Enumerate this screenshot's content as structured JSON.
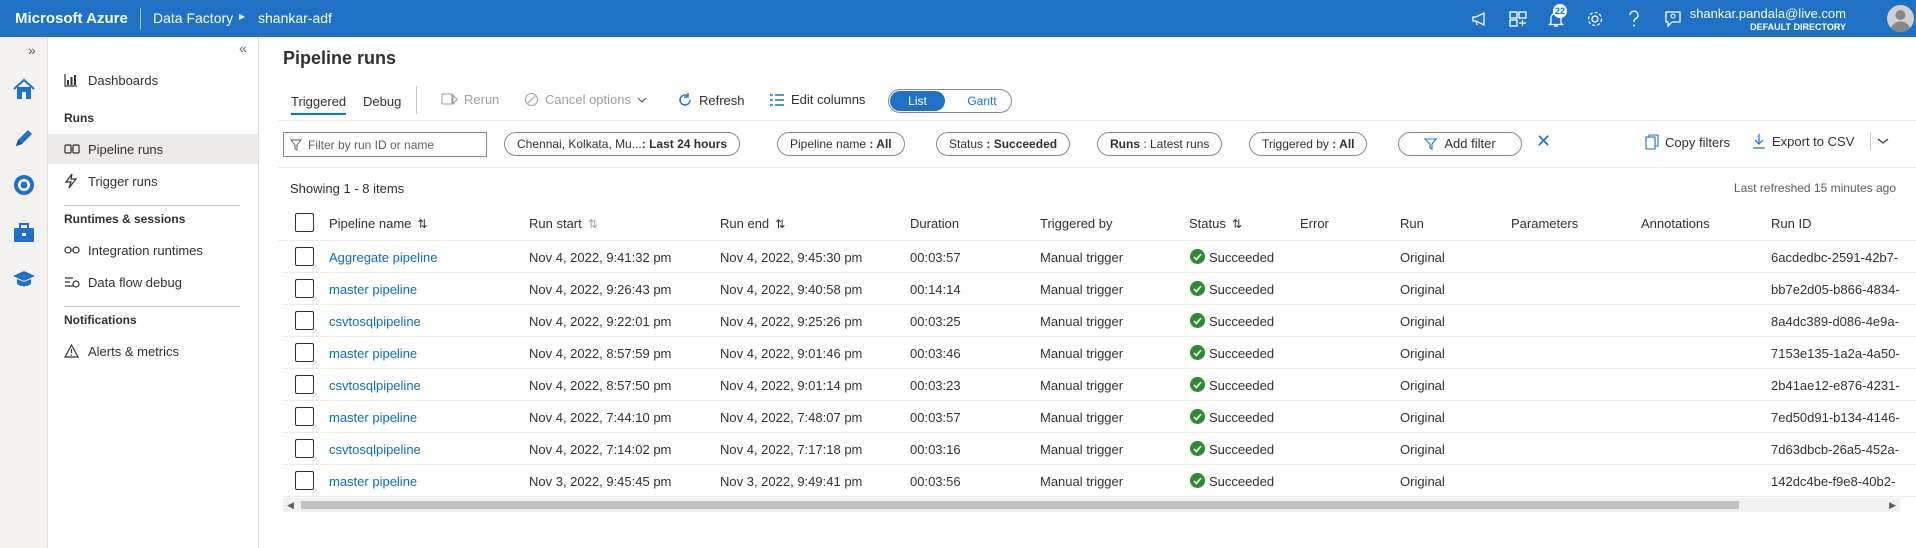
{
  "topbar": {
    "brand": "Microsoft Azure",
    "breadcrumb": [
      "Data Factory",
      "shankar-adf"
    ],
    "notification_count": "22",
    "user_email": "shankar.pandala@live.com",
    "user_directory": "DEFAULT DIRECTORY",
    "icons": [
      "megaphone-icon",
      "portal-icon",
      "bell-icon",
      "gear-icon",
      "help-icon",
      "feedback-icon"
    ]
  },
  "rail": {
    "icons": [
      "home-icon",
      "author-pencil-icon",
      "monitor-icon",
      "manage-toolbox-icon",
      "learning-hat-icon"
    ]
  },
  "sidenav": {
    "dashboards": "Dashboards",
    "runs_header": "Runs",
    "pipeline_runs": "Pipeline runs",
    "trigger_runs": "Trigger runs",
    "runtimes_header": "Runtimes & sessions",
    "integration_runtimes": "Integration runtimes",
    "data_flow_debug": "Data flow debug",
    "notifications_header": "Notifications",
    "alerts": "Alerts & metrics"
  },
  "main": {
    "title": "Pipeline runs",
    "tabs": [
      "Triggered",
      "Debug"
    ],
    "toolbar": {
      "rerun": "Rerun",
      "cancel": "Cancel options",
      "refresh": "Refresh",
      "edit_columns": "Edit columns",
      "view_list": "List",
      "view_gantt": "Gantt"
    },
    "filters": {
      "search_placeholder": "Filter by run ID or name",
      "time_label": "Chennai, Kolkata, Mu...",
      "time_value": ": Last 24 hours",
      "pipeline_label": "Pipeline name",
      "pipeline_value": ": All",
      "status_label": "Status",
      "status_value": ": Succeeded",
      "runs_label": "Runs",
      "runs_value": ": Latest runs",
      "triggered_label": "Triggered by",
      "triggered_value": ": All",
      "add_filter": "Add filter",
      "copy_filters": "Copy filters",
      "export_csv": "Export to CSV"
    },
    "showing": "Showing 1 - 8 items",
    "last_refreshed": "Last refreshed 15 minutes ago",
    "columns": [
      "Pipeline name",
      "Run start",
      "Run end",
      "Duration",
      "Triggered by",
      "Status",
      "Error",
      "Run",
      "Parameters",
      "Annotations",
      "Run ID"
    ],
    "rows": [
      {
        "name": "Aggregate pipeline",
        "start": "Nov 4, 2022, 9:41:32 pm",
        "end": "Nov 4, 2022, 9:45:30 pm",
        "duration": "00:03:57",
        "triggered": "Manual trigger",
        "status": "Succeeded",
        "run": "Original",
        "run_id": "6acdedbc-2591-42b7-"
      },
      {
        "name": "master pipeline",
        "start": "Nov 4, 2022, 9:26:43 pm",
        "end": "Nov 4, 2022, 9:40:58 pm",
        "duration": "00:14:14",
        "triggered": "Manual trigger",
        "status": "Succeeded",
        "run": "Original",
        "run_id": "bb7e2d05-b866-4834-"
      },
      {
        "name": "csvtosqlpipeline",
        "start": "Nov 4, 2022, 9:22:01 pm",
        "end": "Nov 4, 2022, 9:25:26 pm",
        "duration": "00:03:25",
        "triggered": "Manual trigger",
        "status": "Succeeded",
        "run": "Original",
        "run_id": "8a4dc389-d086-4e9a-"
      },
      {
        "name": "master pipeline",
        "start": "Nov 4, 2022, 8:57:59 pm",
        "end": "Nov 4, 2022, 9:01:46 pm",
        "duration": "00:03:46",
        "triggered": "Manual trigger",
        "status": "Succeeded",
        "run": "Original",
        "run_id": "7153e135-1a2a-4a50-"
      },
      {
        "name": "csvtosqlpipeline",
        "start": "Nov 4, 2022, 8:57:50 pm",
        "end": "Nov 4, 2022, 9:01:14 pm",
        "duration": "00:03:23",
        "triggered": "Manual trigger",
        "status": "Succeeded",
        "run": "Original",
        "run_id": "2b41ae12-e876-4231-"
      },
      {
        "name": "master pipeline",
        "start": "Nov 4, 2022, 7:44:10 pm",
        "end": "Nov 4, 2022, 7:48:07 pm",
        "duration": "00:03:57",
        "triggered": "Manual trigger",
        "status": "Succeeded",
        "run": "Original",
        "run_id": "7ed50d91-b134-4146-"
      },
      {
        "name": "csvtosqlpipeline",
        "start": "Nov 4, 2022, 7:14:02 pm",
        "end": "Nov 4, 2022, 7:17:18 pm",
        "duration": "00:03:16",
        "triggered": "Manual trigger",
        "status": "Succeeded",
        "run": "Original",
        "run_id": "7d63dbcb-26a5-452a-"
      },
      {
        "name": "master pipeline",
        "start": "Nov 3, 2022, 9:45:45 pm",
        "end": "Nov 3, 2022, 9:49:41 pm",
        "duration": "00:03:56",
        "triggered": "Manual trigger",
        "status": "Succeeded",
        "run": "Original",
        "run_id": "142dc4be-f9e8-40b2-"
      }
    ]
  }
}
